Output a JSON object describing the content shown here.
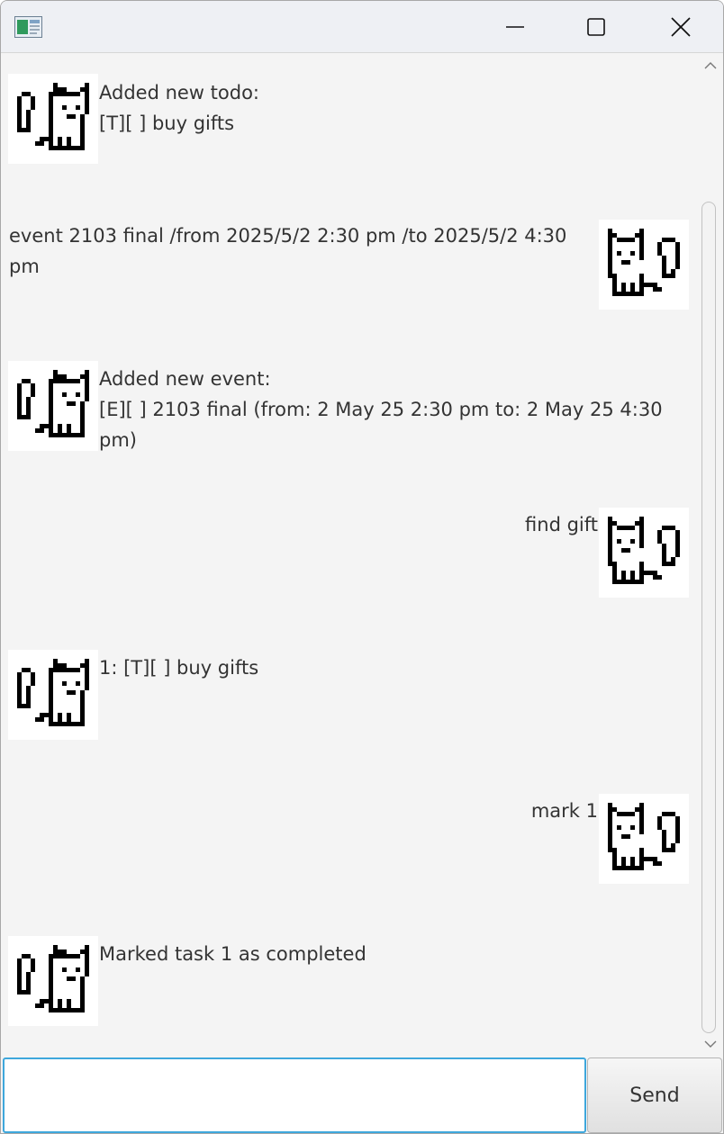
{
  "window": {
    "app_icon": "app-window-icon",
    "controls": [
      "minimize-icon",
      "maximize-icon",
      "close-icon"
    ]
  },
  "messages": [
    {
      "sender": "bot",
      "line1": "Added new todo:",
      "line2": "[T][ ] buy gifts"
    },
    {
      "sender": "user",
      "line1": "event 2103 final /from 2025/5/2 2:30 pm /to 2025/5/2 4:30",
      "line2": "pm"
    },
    {
      "sender": "bot",
      "line1": "Added new event:",
      "line2": "[E][ ] 2103 final (from: 2 May 25 2:30 pm to: 2 May 25 4:30",
      "line3": "pm)"
    },
    {
      "sender": "user",
      "line1": "find gift"
    },
    {
      "sender": "bot",
      "line1": "1: [T][ ] buy gifts"
    },
    {
      "sender": "user",
      "line1": "mark 1"
    },
    {
      "sender": "bot",
      "line1": "Marked task 1 as completed"
    }
  ],
  "avatars": {
    "bot": "cat-with-bow-avatar-icon",
    "user": "cat-avatar-icon"
  },
  "input": {
    "value": "",
    "placeholder": ""
  },
  "send_label": "Send",
  "colors": {
    "input_focus_border": "#3ea7dc",
    "background": "#f4f4f4",
    "text": "#333333"
  }
}
